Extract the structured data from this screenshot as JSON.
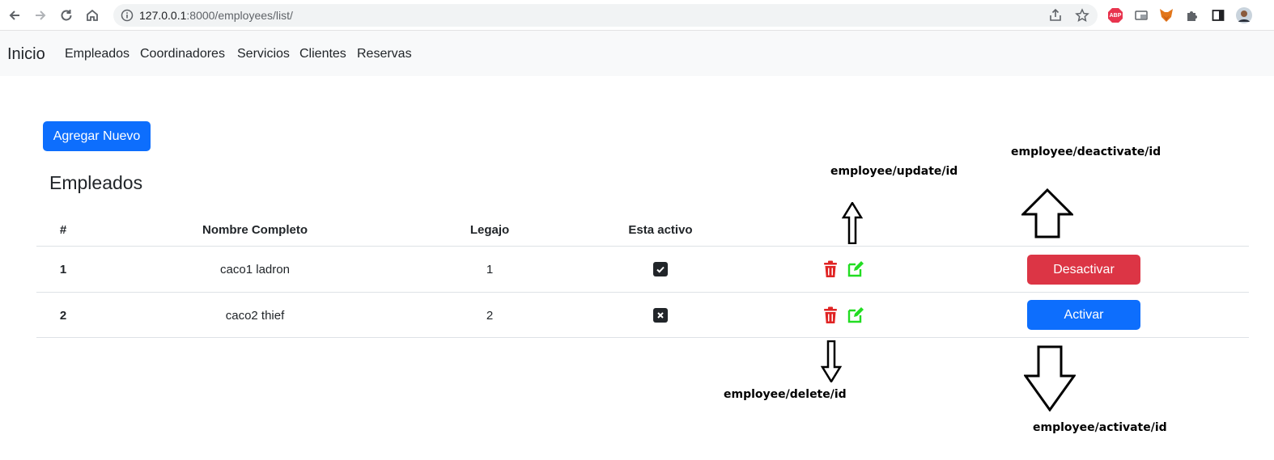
{
  "browser": {
    "url_host": "127.0.0.1",
    "url_path": ":8000/employees/list/",
    "extensions": [
      "share-icon",
      "star-icon",
      "abp-icon",
      "cast-icon",
      "fox-icon",
      "puzzle-icon",
      "sidebar-icon",
      "avatar"
    ],
    "abp_label": "ABP"
  },
  "navbar": {
    "brand": "Inicio",
    "links": [
      "Empleados",
      "Coordinadores",
      "Servicios",
      "Clientes",
      "Reservas"
    ]
  },
  "add_button": "Agregar Nuevo",
  "page_title": "Empleados",
  "table": {
    "headers": [
      "#",
      "Nombre Completo",
      "Legajo",
      "Esta activo"
    ],
    "rows": [
      {
        "id": "1",
        "name": "caco1 ladron",
        "legajo": "1",
        "active": true,
        "action_label": "Desactivar"
      },
      {
        "id": "2",
        "name": "caco2 thief",
        "legajo": "2",
        "active": false,
        "action_label": "Activar"
      }
    ]
  },
  "annotations": {
    "update": "employee/update/id",
    "deactivate": "employee/deactivate/id",
    "delete": "employee/delete/id",
    "activate": "employee/activate/id"
  },
  "colors": {
    "primary": "#0d6efd",
    "danger": "#dc3545",
    "delete_icon": "#e02424",
    "edit_icon": "#22dd22"
  }
}
